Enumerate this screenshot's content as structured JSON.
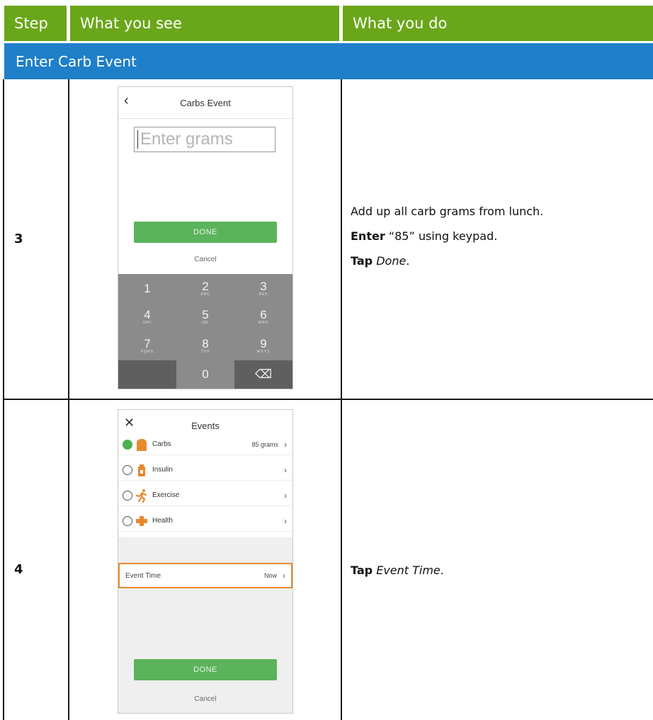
{
  "table": {
    "headers": [
      "Step",
      "What you see",
      "What you do"
    ],
    "section_title": "Enter Carb Event",
    "rows": [
      {
        "step": "3",
        "phone": {
          "title": "Carbs Event",
          "back_icon": "chevron-left-icon",
          "input_placeholder": "Enter grams",
          "done_label": "DONE",
          "cancel_label": "Cancel",
          "keys": [
            {
              "k": "1",
              "s": ""
            },
            {
              "k": "2",
              "s": "ABC"
            },
            {
              "k": "3",
              "s": "DEF"
            },
            {
              "k": "4",
              "s": "GHI"
            },
            {
              "k": "5",
              "s": "JKL"
            },
            {
              "k": "6",
              "s": "MNO"
            },
            {
              "k": "7",
              "s": "PQRS"
            },
            {
              "k": "8",
              "s": "TUV"
            },
            {
              "k": "9",
              "s": "WXYZ"
            },
            {
              "k": "",
              "s": ""
            },
            {
              "k": "0",
              "s": ""
            },
            {
              "k": "⌫",
              "s": ""
            }
          ]
        },
        "instructions": {
          "line1": "Add up all carb grams from lunch.",
          "line2_bold": "Enter",
          "line2_rest": " “85” using keypad.",
          "line3_bold": "Tap",
          "line3_italic": "Done",
          "line3_end": "."
        }
      },
      {
        "step": "4",
        "phone": {
          "title": "Events",
          "close_icon": "close-icon",
          "events": [
            {
              "label": "Carbs",
              "value": "85 grams",
              "selected": true,
              "icon": "carbs-icon",
              "color": "#e8892e"
            },
            {
              "label": "Insulin",
              "value": "",
              "selected": false,
              "icon": "insulin-icon",
              "color": "#e8892e"
            },
            {
              "label": "Exercise",
              "value": "",
              "selected": false,
              "icon": "exercise-icon",
              "color": "#e8892e"
            },
            {
              "label": "Health",
              "value": "",
              "selected": false,
              "icon": "health-icon",
              "color": "#e8892e"
            }
          ],
          "event_time_label": "Event Time",
          "event_time_value": "Now",
          "done_label": "DONE",
          "cancel_label": "Cancel"
        },
        "instructions": {
          "bold": "Tap",
          "italic": "Event Time",
          "end": "."
        }
      }
    ]
  },
  "colors": {
    "header_green": "#6aa61a",
    "section_blue": "#1f7fc9",
    "done_green": "#5bb35b",
    "highlight_orange": "#e78a2e"
  }
}
